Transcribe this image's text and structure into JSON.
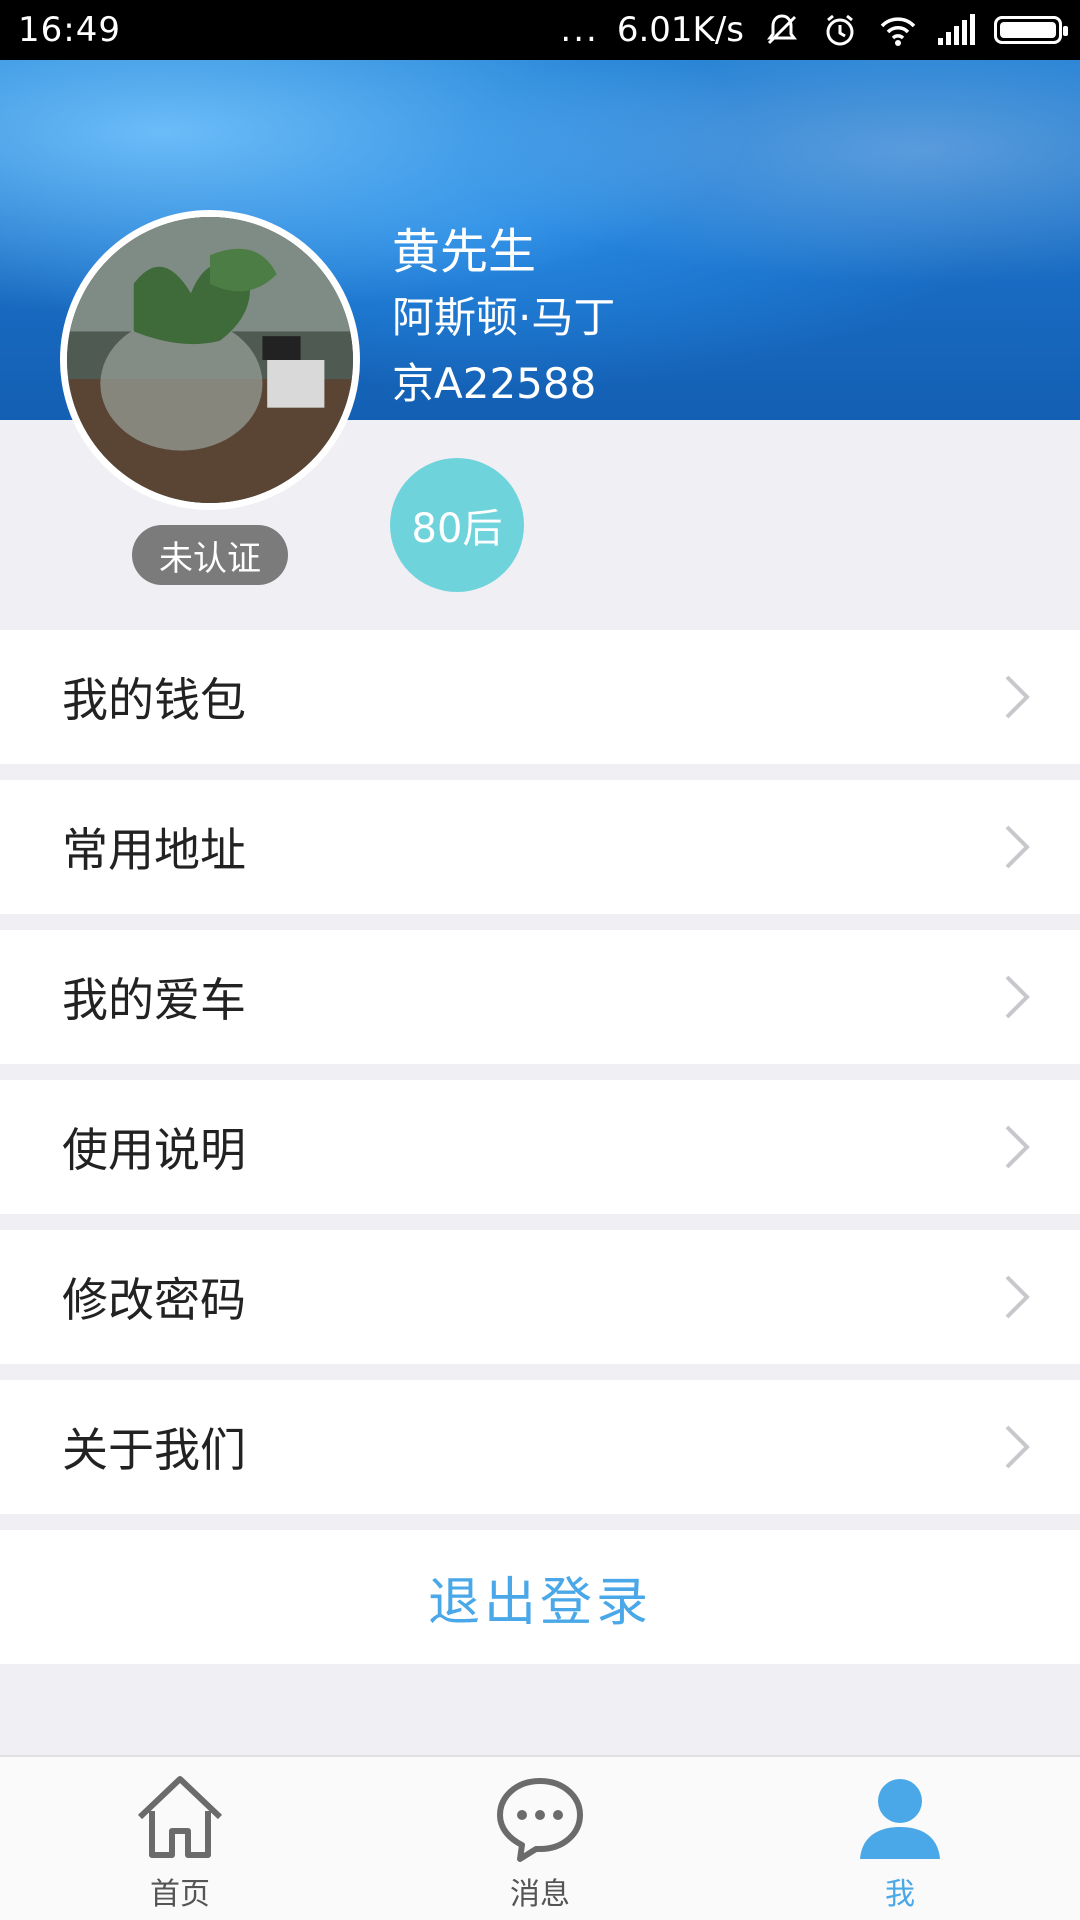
{
  "status_bar": {
    "time": "16:49",
    "dots": "...",
    "speed": "6.01K/s"
  },
  "profile": {
    "name": "黄先生",
    "car_model": "阿斯顿·马丁",
    "plate": "京A22588",
    "verify_status": "未认证",
    "age_group": "80后"
  },
  "menu": {
    "items": [
      {
        "label": "我的钱包"
      },
      {
        "label": "常用地址"
      },
      {
        "label": "我的爱车"
      },
      {
        "label": "使用说明"
      },
      {
        "label": "修改密码"
      },
      {
        "label": "关于我们"
      }
    ],
    "logout_label": "退出登录"
  },
  "tabbar": {
    "tabs": [
      {
        "label": "首页",
        "icon": "home-icon"
      },
      {
        "label": "消息",
        "icon": "message-icon"
      },
      {
        "label": "我",
        "icon": "user-icon",
        "active": true
      }
    ]
  },
  "colors": {
    "accent": "#4aa8e8",
    "age_badge": "#6fd3dc",
    "verify_badge": "#7b7b7b"
  }
}
